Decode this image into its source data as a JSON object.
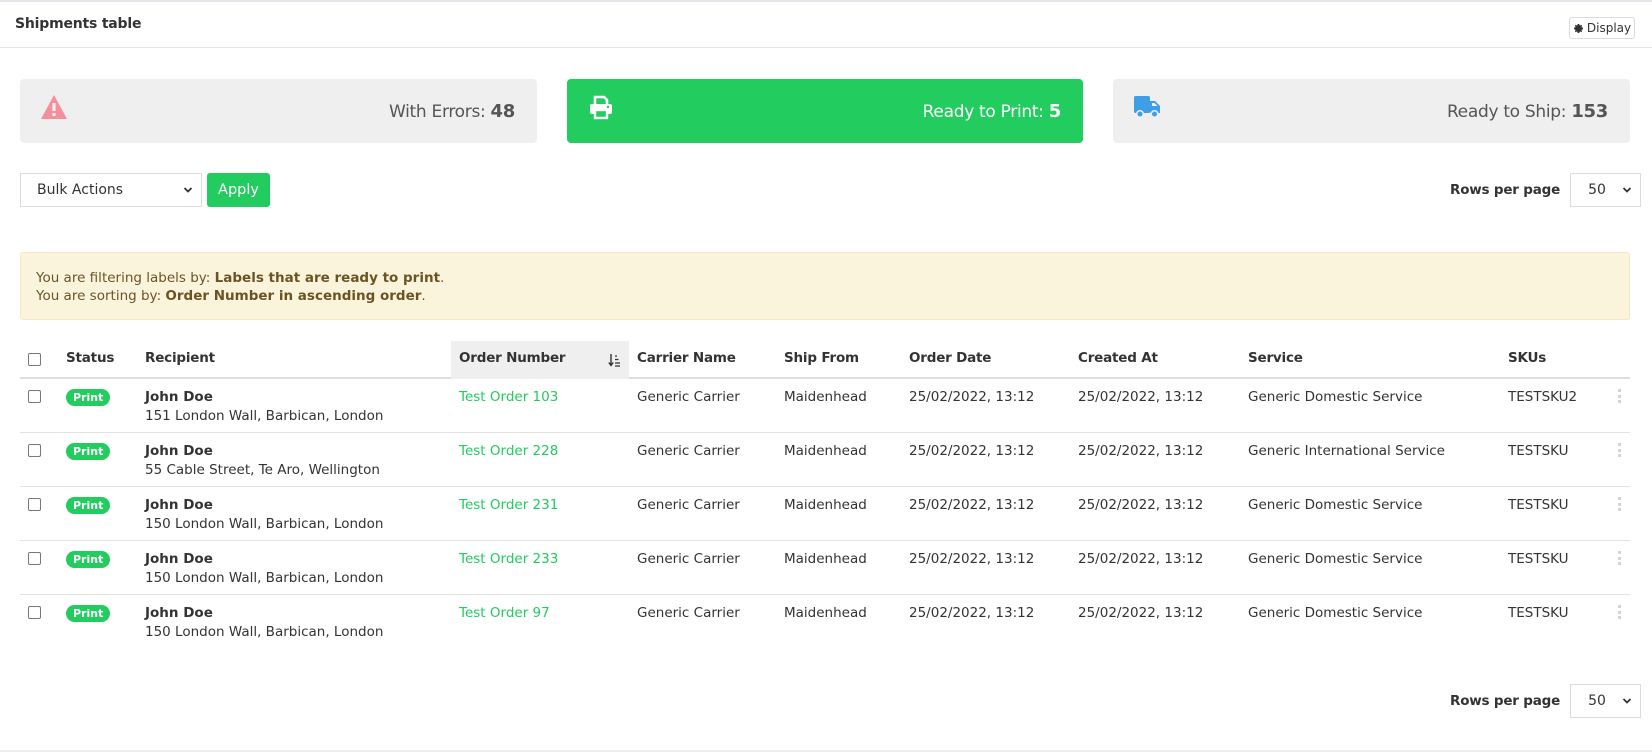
{
  "header": {
    "title": "Shipments table",
    "display_button": {
      "label": "Display",
      "icon": "gear-icon"
    }
  },
  "stats": [
    {
      "id": "errors",
      "label": "With Errors:",
      "count": "48",
      "icon": "warning-triangle-icon",
      "icon_color": "#f48f9c",
      "active": false
    },
    {
      "id": "print",
      "label": "Ready to Print:",
      "count": "5",
      "icon": "printer-icon",
      "icon_color": "#ffffff",
      "active": true
    },
    {
      "id": "ship",
      "label": "Ready to Ship:",
      "count": "153",
      "icon": "truck-icon",
      "icon_color": "#3f9fe6",
      "active": false
    }
  ],
  "toolbar": {
    "bulk_actions": {
      "selected": "Bulk Actions"
    },
    "apply_label": "Apply",
    "rows_per_page_label": "Rows per page",
    "rows_per_page_value": "50"
  },
  "alert": {
    "filter_prefix": "You are filtering labels by: ",
    "filter_value": "Labels that are ready to print",
    "sort_prefix": "You are sorting by: ",
    "sort_value": "Order Number in ascending order",
    "period": "."
  },
  "table": {
    "columns": [
      "Status",
      "Recipient",
      "Order Number",
      "Carrier Name",
      "Ship From",
      "Order Date",
      "Created At",
      "Service",
      "SKUs"
    ],
    "sorted_column": "Order Number",
    "sort_direction": "ascending",
    "rows": [
      {
        "status": "Print",
        "name": "John Doe",
        "address": "151 London Wall, Barbican, London",
        "order": "Test Order 103",
        "carrier": "Generic Carrier",
        "ship_from": "Maidenhead",
        "order_date": "25/02/2022, 13:12",
        "created_at": "25/02/2022, 13:12",
        "service": "Generic Domestic Service",
        "sku": "TESTSKU2"
      },
      {
        "status": "Print",
        "name": "John Doe",
        "address": "55 Cable Street, Te Aro, Wellington",
        "order": "Test Order 228",
        "carrier": "Generic Carrier",
        "ship_from": "Maidenhead",
        "order_date": "25/02/2022, 13:12",
        "created_at": "25/02/2022, 13:12",
        "service": "Generic International Service",
        "sku": "TESTSKU"
      },
      {
        "status": "Print",
        "name": "John Doe",
        "address": "150 London Wall, Barbican, London",
        "order": "Test Order 231",
        "carrier": "Generic Carrier",
        "ship_from": "Maidenhead",
        "order_date": "25/02/2022, 13:12",
        "created_at": "25/02/2022, 13:12",
        "service": "Generic Domestic Service",
        "sku": "TESTSKU"
      },
      {
        "status": "Print",
        "name": "John Doe",
        "address": "150 London Wall, Barbican, London",
        "order": "Test Order 233",
        "carrier": "Generic Carrier",
        "ship_from": "Maidenhead",
        "order_date": "25/02/2022, 13:12",
        "created_at": "25/02/2022, 13:12",
        "service": "Generic Domestic Service",
        "sku": "TESTSKU"
      },
      {
        "status": "Print",
        "name": "John Doe",
        "address": "150 London Wall, Barbican, London",
        "order": "Test Order 97",
        "carrier": "Generic Carrier",
        "ship_from": "Maidenhead",
        "order_date": "25/02/2022, 13:12",
        "created_at": "25/02/2022, 13:12",
        "service": "Generic Domestic Service",
        "sku": "TESTSKU"
      }
    ]
  },
  "colors": {
    "accent_green": "#22cc5e",
    "alert_bg": "#fbf4dc",
    "alert_text": "#6b5424",
    "card_bg": "#efefef"
  }
}
